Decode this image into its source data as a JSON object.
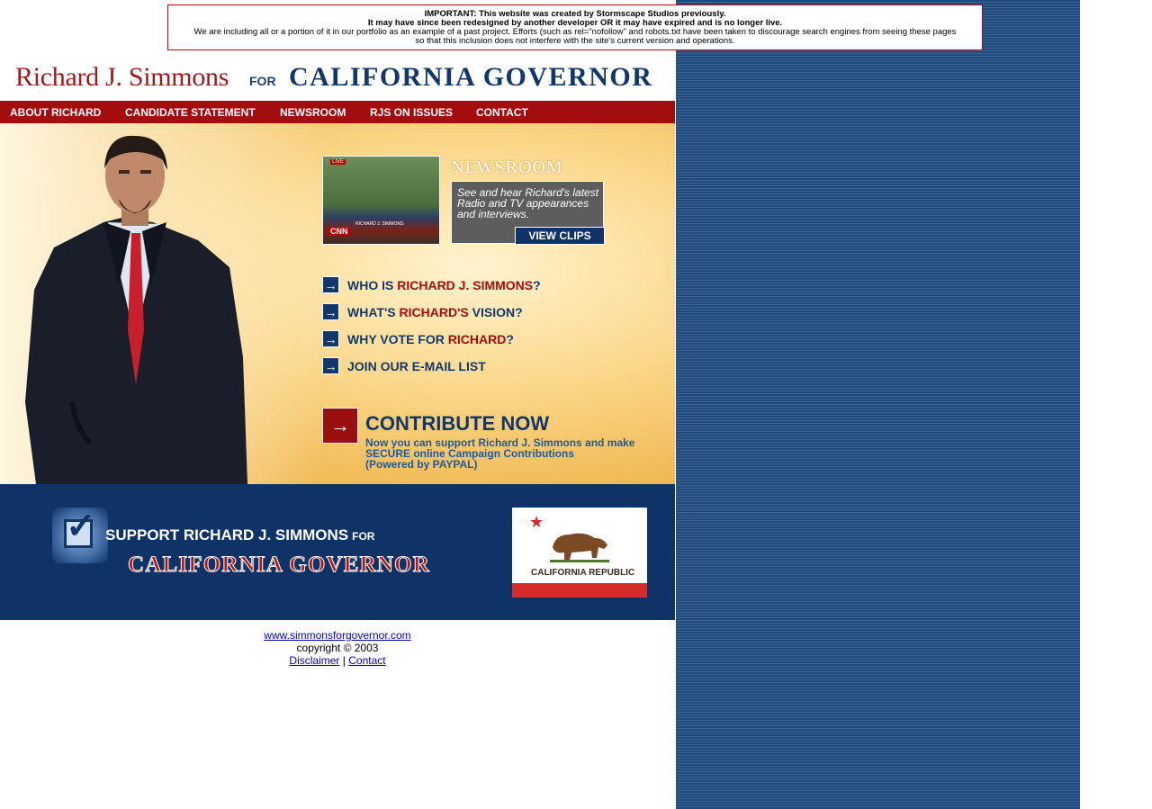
{
  "notice": {
    "line1": "IMPORTANT: This website was created by Stormscape Studios previously.",
    "line2": "It may have since been redesigned by another developer OR it may have expired and is no longer live.",
    "line3": "We are including all or a portion of it in our portfolio as an example of a past project. Efforts (such as rel=\"nofollow\" and robots.txt have been taken to discourage search engines from seeing these pages",
    "line4": "so that this inclusion does not interfere with the site's current version and operations."
  },
  "header": {
    "name": "Richard J. Simmons",
    "for": "FOR",
    "governor": "CALIFORNIA GOVERNOR"
  },
  "nav": [
    "ABOUT RICHARD",
    "CANDIDATE STATEMENT",
    "NEWSROOM",
    "RJS ON ISSUES",
    "CONTACT"
  ],
  "newsroom": {
    "title": "NEWSROOM",
    "thumb_live": "LIVE",
    "thumb_cnn": "CNN",
    "thumb_caption": "RICHARD J. SIMMONS",
    "description": "See and hear Richard's latest Radio and TV appearances and interviews.",
    "button": "VIEW CLIPS"
  },
  "links": [
    {
      "pre": "WHO IS ",
      "red": "RICHARD J. SIMMONS",
      "post": "?"
    },
    {
      "pre": "WHAT'S ",
      "red": "RICHARD'S",
      "post": " VISION?"
    },
    {
      "pre": "WHY VOTE FOR ",
      "red": "RICHARD",
      "post": "?"
    },
    {
      "pre": "JOIN OUR E-MAIL LIST",
      "red": "",
      "post": ""
    }
  ],
  "arrow_glyph": "→",
  "contribute": {
    "title": "CONTRIBUTE NOW",
    "line1": "Now you can support Richard J. Simmons and make",
    "line2": "SECURE online Campaign Contributions",
    "line3": "(Powered by PAYPAL)"
  },
  "banner": {
    "support": "SUPPORT RICHARD J. SIMMONS",
    "for": "FOR",
    "governor": "CALIFORNIA GOVERNOR",
    "flag_text": "CALIFORNIA REPUBLIC"
  },
  "footer": {
    "url": "www.simmonsforgovernor.com",
    "copyright": "copyright © 2003",
    "disclaimer": "Disclaimer",
    "separator": "|",
    "contact": "Contact"
  },
  "colors": {
    "brand_red": "#a30d0d",
    "brand_navy": "#12386b",
    "banner_navy": "#0f3366"
  }
}
